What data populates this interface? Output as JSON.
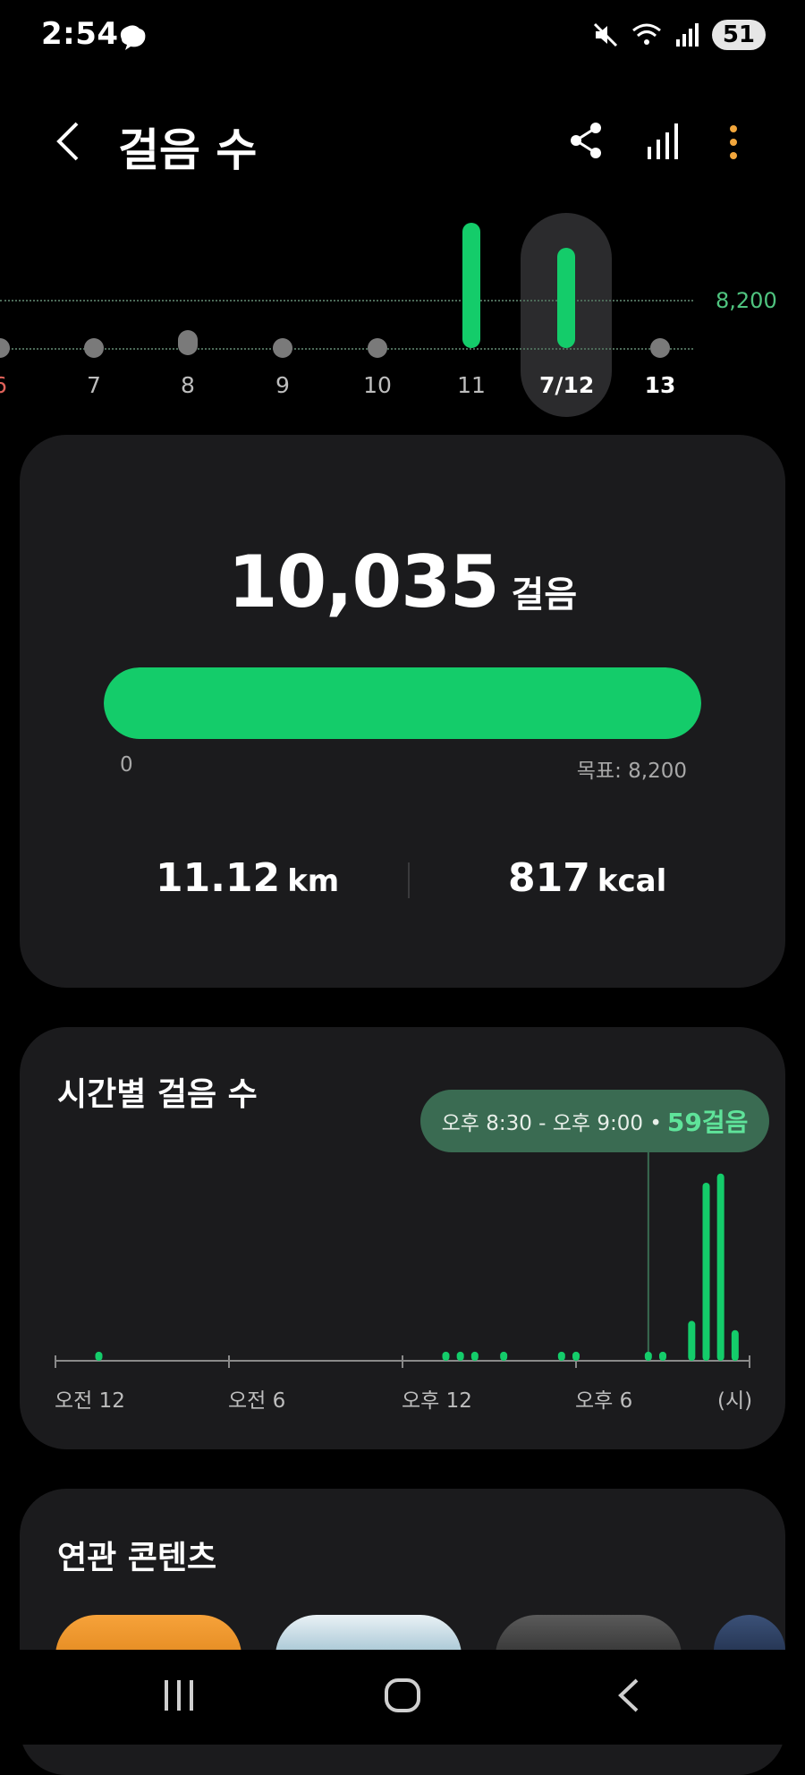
{
  "status": {
    "time": "2:54",
    "battery": "51"
  },
  "header": {
    "title": "걸음 수"
  },
  "days": [
    {
      "label": "6",
      "steps": 0
    },
    {
      "label": "7",
      "steps": 0
    },
    {
      "label": "8",
      "steps": 0
    },
    {
      "label": "9",
      "steps": 0
    },
    {
      "label": "10",
      "steps": 0
    },
    {
      "label": "11",
      "steps": 12500
    },
    {
      "label": "7/12",
      "steps": 10035
    },
    {
      "label": "13",
      "steps": 0
    }
  ],
  "goal_line_label": "8,200",
  "summary": {
    "steps": "10,035",
    "steps_unit": "걸음",
    "progress_fraction": 1.0,
    "progress_min": "0",
    "goal_label": "목표: 8,200",
    "distance_value": "11.12",
    "distance_unit": "km",
    "calories_value": "817",
    "calories_unit": "kcal"
  },
  "hourly": {
    "title": "시간별 걸음 수",
    "tooltip_range": "오후 8:30 - 오후 9:00 •",
    "tooltip_value": "59걸음",
    "axis_labels": [
      "오전 12",
      "오전 6",
      "오후 12",
      "오후 6",
      "(시)"
    ]
  },
  "chart_data": {
    "type": "bar",
    "title": "시간별 걸음 수",
    "x_unit": "hour",
    "xlim": [
      0,
      24
    ],
    "x": [
      1.5,
      13.5,
      14.0,
      14.5,
      15.5,
      17.5,
      18.0,
      20.5,
      21.0,
      22.0,
      22.5,
      23.0,
      23.5
    ],
    "values": [
      59,
      59,
      59,
      59,
      59,
      59,
      59,
      59,
      59,
      260,
      1160,
      1220,
      200
    ],
    "highlight": {
      "x": 20.5,
      "value": 59
    }
  },
  "related": {
    "title": "연관 콘텐츠"
  },
  "colors": {
    "accent": "#14cc6a",
    "card": "#1b1b1d",
    "tooltip": "#3a6b52"
  }
}
